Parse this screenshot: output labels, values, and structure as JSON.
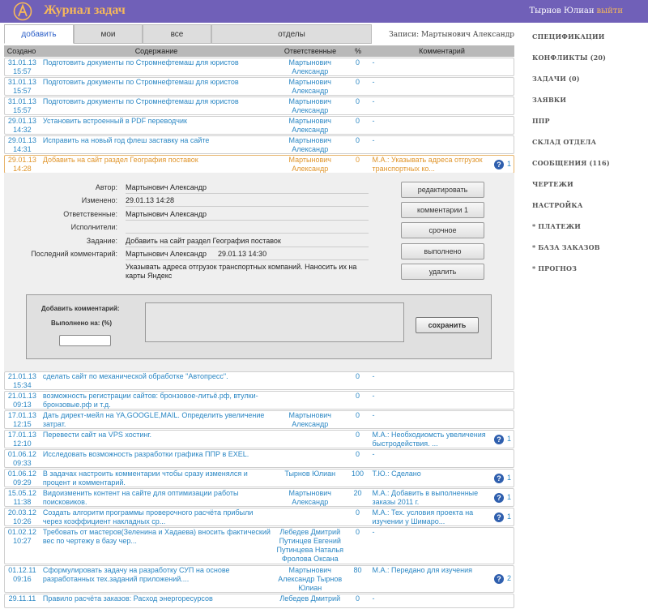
{
  "app": {
    "title": "Журнал задач",
    "user": "Тырнов Юлиан",
    "exit": "выйти"
  },
  "tabs": [
    "добавить",
    "мои",
    "все",
    "отделы"
  ],
  "records_label": "Записи: Мартынович Александр",
  "columns": {
    "created": "Создано",
    "content": "Содержание",
    "resp": "Ответственные",
    "pct": "%",
    "comment": "Комментарий"
  },
  "rows_top": [
    {
      "date": "31.01.13",
      "time": "15:57",
      "text": "Подготовить документы по Стромнефтемаш для юристов",
      "resp": "Мартынович Александр",
      "pct": "0",
      "comment": "-"
    },
    {
      "date": "31.01.13",
      "time": "15:57",
      "text": "Подготовить документы по Стромнефтемаш для юристов",
      "resp": "Мартынович Александр",
      "pct": "0",
      "comment": "-"
    },
    {
      "date": "31.01.13",
      "time": "15:57",
      "text": "Подготовить документы по Стромнефтемаш для юристов",
      "resp": "Мартынович Александр",
      "pct": "0",
      "comment": "-"
    },
    {
      "date": "29.01.13",
      "time": "14:32",
      "text": "Установить встроенный в PDF переводчик",
      "resp": "Мартынович Александр",
      "pct": "0",
      "comment": "-"
    },
    {
      "date": "29.01.13",
      "time": "14:31",
      "text": "Исправить на новый год флеш заставку на сайте",
      "resp": "Мартынович Александр",
      "pct": "0",
      "comment": "-"
    },
    {
      "date": "29.01.13",
      "time": "14:28",
      "text": "Добавить на сайт раздел География поставок",
      "resp": "Мартынович Александр",
      "pct": "0",
      "comment": "М.А.: Указывать адреса отгрузок транспортных ко...",
      "count": "1"
    }
  ],
  "detail": {
    "labels": [
      "Автор:",
      "Изменено:",
      "Ответственные:",
      "Исполнители:",
      "Задание:",
      "Последний комментарий:"
    ],
    "author": "Мартынович Александр",
    "modified": "29.01.13 14:28",
    "resp": "Мартынович Александр",
    "executors": "",
    "task": "Добавить на сайт раздел География поставок",
    "last_comment_author": "Мартынович Александр",
    "last_comment_date": "29.01.13 14:30",
    "last_comment_text": "Указывать адреса отгрузок транспортных компаний. Наносить их на карты Яндекс",
    "buttons": [
      "редактировать",
      "комментарии 1",
      "срочное",
      "выполнено",
      "удалить"
    ],
    "add_comment_label": "Добавить комментарий:",
    "done_label": "Выполнено на: (%)",
    "save": "сохранить"
  },
  "rows_bottom": [
    {
      "date": "21.01.13",
      "time": "15:34",
      "text": "сделать сайт по механической обработке \"Автопресс\".",
      "resp": "",
      "pct": "0",
      "comment": "-"
    },
    {
      "date": "21.01.13",
      "time": "09:13",
      "text": "возможность регистрации сайтов: бронзовое-литьё.рф, втулки-бронзовые.рф и т.д.",
      "resp": "",
      "pct": "0",
      "comment": "-"
    },
    {
      "date": "17.01.13",
      "time": "12:15",
      "text": "Дать директ-мейл на YA,GOOGLE,MAIL. Определить увеличение затрат.",
      "resp": "Мартынович Александр",
      "pct": "0",
      "comment": "-"
    },
    {
      "date": "17.01.13",
      "time": "12:10",
      "text": "Перевести сайт на VPS хостинг.",
      "resp": "",
      "pct": "0",
      "comment": "М.А.: Необходиомсть увеличения быстродействия. ...",
      "count": "1"
    },
    {
      "date": "01.06.12",
      "time": "09:33",
      "text": "Исследовать возможность разработки графика ППР в EXEL.",
      "resp": "",
      "pct": "0",
      "comment": "-"
    },
    {
      "date": "01.06.12",
      "time": "09:29",
      "text": "В задачах настроить комментарии чтобы сразу изменялся и процент и комментарий.",
      "resp": "Тырнов Юлиан",
      "pct": "100",
      "comment": "Т.Ю.: Сделано",
      "count": "1"
    },
    {
      "date": "15.05.12",
      "time": "11:38",
      "text": "Видоизменить контент на сайте для оптимизации работы поисковиков.",
      "resp": "Мартынович Александр",
      "pct": "20",
      "comment": "М.А.: Добавить в выполненные заказы 2011 г.",
      "count": "1"
    },
    {
      "date": "20.03.12",
      "time": "10:26",
      "text": "Создать алгоритм программы проверочного расчёта прибыли через коэффициент накладных ср...",
      "resp": "",
      "pct": "0",
      "comment": "М.А.: Тех. условия проекта на изучении у Шимаро...",
      "count": "1"
    },
    {
      "date": "01.02.12",
      "time": "10:27",
      "text": "Требовать от мастеров(Зеленина и Хадаева) вносить фактический вес по чертежу в базу чер...",
      "resp": "Лебедев Дмитрий Путинцев Евгений Путинцева Наталья Фролова Оксана",
      "pct": "0",
      "comment": "-"
    },
    {
      "date": "01.12.11",
      "time": "09:16",
      "text": "Сформулировать задачу на разработку СУП на основе разработанных тех.заданий приложений....",
      "resp": "Мартынович Александр Тырнов Юлиан",
      "pct": "80",
      "comment": "М.А.: Передано для изучения",
      "count": "2"
    },
    {
      "date": "29.11.11",
      "time": "",
      "text": "Правило расчёта заказов: Расход энергоресурсов",
      "resp": "Лебедев Дмитрий",
      "pct": "0",
      "comment": "-"
    }
  ],
  "sidebar": [
    "СПЕЦИФИКАЦИИ",
    "КОНФЛИКТЫ (20)",
    "ЗАДАЧИ (0)",
    "ЗАЯВКИ",
    "ППР",
    "СКЛАД ОТДЕЛА",
    "СООБЩЕНИЯ (116)",
    "ЧЕРТЕЖИ",
    "НАСТРОЙКА",
    "* ПЛАТЕЖИ",
    "* БАЗА ЗАКАЗОВ",
    "* ПРОГНОЗ"
  ]
}
